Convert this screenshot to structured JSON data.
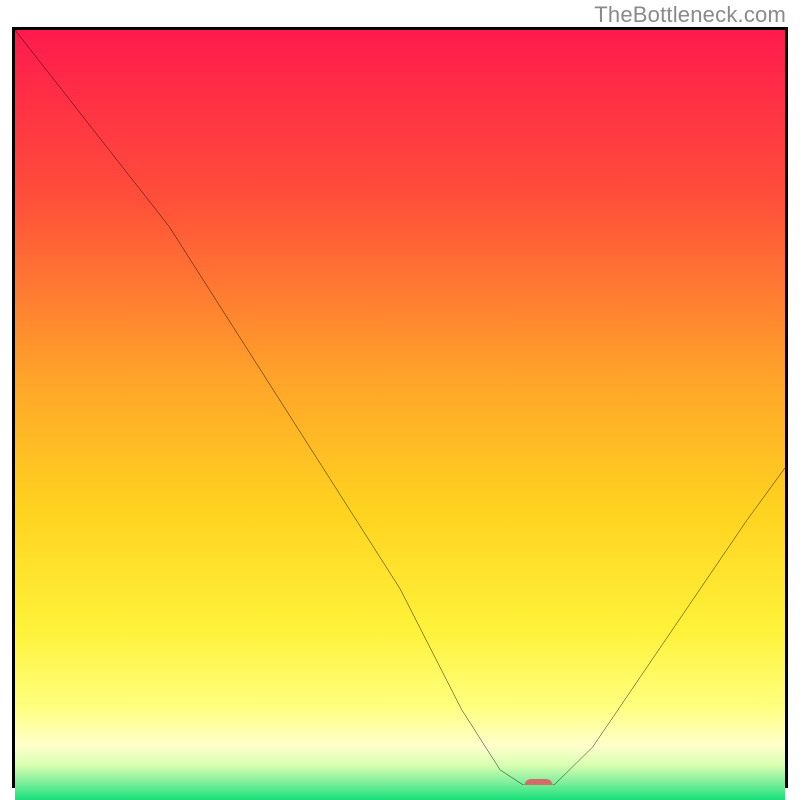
{
  "watermark": "TheBottleneck.com",
  "chart_data": {
    "type": "line",
    "title": "",
    "xlabel": "",
    "ylabel": "",
    "xlim": [
      0,
      100
    ],
    "ylim": [
      0,
      100
    ],
    "grid": false,
    "series": [
      {
        "name": "bottleneck-curve",
        "x": [
          0,
          10,
          20,
          30,
          40,
          50,
          58,
          63,
          66,
          70,
          75,
          85,
          95,
          100
        ],
        "y": [
          100,
          87,
          74,
          58,
          42,
          26,
          10,
          2,
          0,
          0,
          5,
          20,
          35,
          42
        ]
      }
    ],
    "annotations": [
      {
        "name": "highlight-marker",
        "x": 68,
        "y": 0
      }
    ]
  },
  "gradient_stops": [
    {
      "pct": 0.0,
      "color": "#ff1a4d"
    },
    {
      "pct": 0.22,
      "color": "#ff4f3a"
    },
    {
      "pct": 0.45,
      "color": "#ffa32a"
    },
    {
      "pct": 0.62,
      "color": "#ffd21f"
    },
    {
      "pct": 0.78,
      "color": "#fff23a"
    },
    {
      "pct": 0.88,
      "color": "#ffff80"
    },
    {
      "pct": 0.93,
      "color": "#ffffcc"
    },
    {
      "pct": 0.955,
      "color": "#d7ffb0"
    },
    {
      "pct": 0.975,
      "color": "#88f0a0"
    },
    {
      "pct": 1.0,
      "color": "#18e07a"
    }
  ]
}
